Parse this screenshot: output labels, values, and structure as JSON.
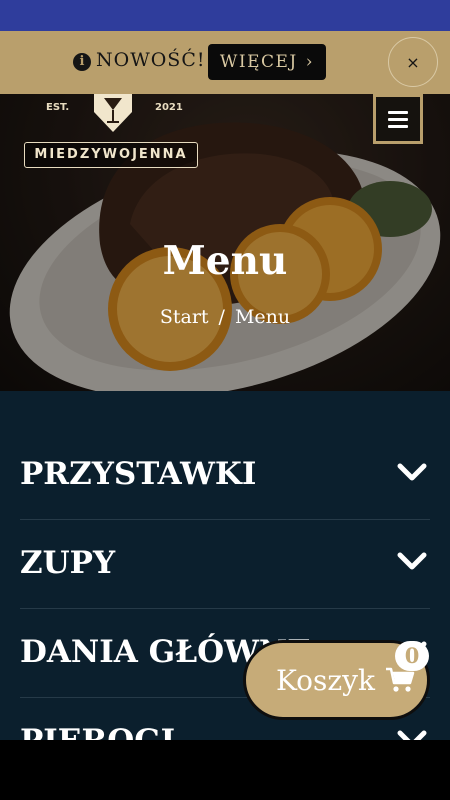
{
  "promo": {
    "text": "NOWOŚĆ!",
    "more_label": "WIĘCEJ",
    "more_chevron": "›",
    "close_label": "×",
    "info_glyph": "i"
  },
  "logo": {
    "est": "EST.",
    "year": "2021",
    "name": "MIEDZYWOJENNA"
  },
  "hero": {
    "title": "Menu",
    "breadcrumb": {
      "home": "Start",
      "separator": "/",
      "current": "Menu"
    }
  },
  "categories": [
    {
      "label": "PRZYSTAWKI",
      "icon": "chevron-down-icon"
    },
    {
      "label": "ZUPY",
      "icon": "chevron-down-icon"
    },
    {
      "label": "DANIA GŁÓWNE",
      "icon": "chevron-down-icon"
    },
    {
      "label": "PIEROGI",
      "icon": "chevron-down-icon"
    }
  ],
  "cart": {
    "label": "Koszyk",
    "count": "0",
    "icon": "shopping-cart-icon"
  },
  "colors": {
    "status_bar": "#2f3d9c",
    "promo_bar": "#b99f6c",
    "menu_background": "#0b1f2d",
    "cart_button": "#c6ab78"
  }
}
